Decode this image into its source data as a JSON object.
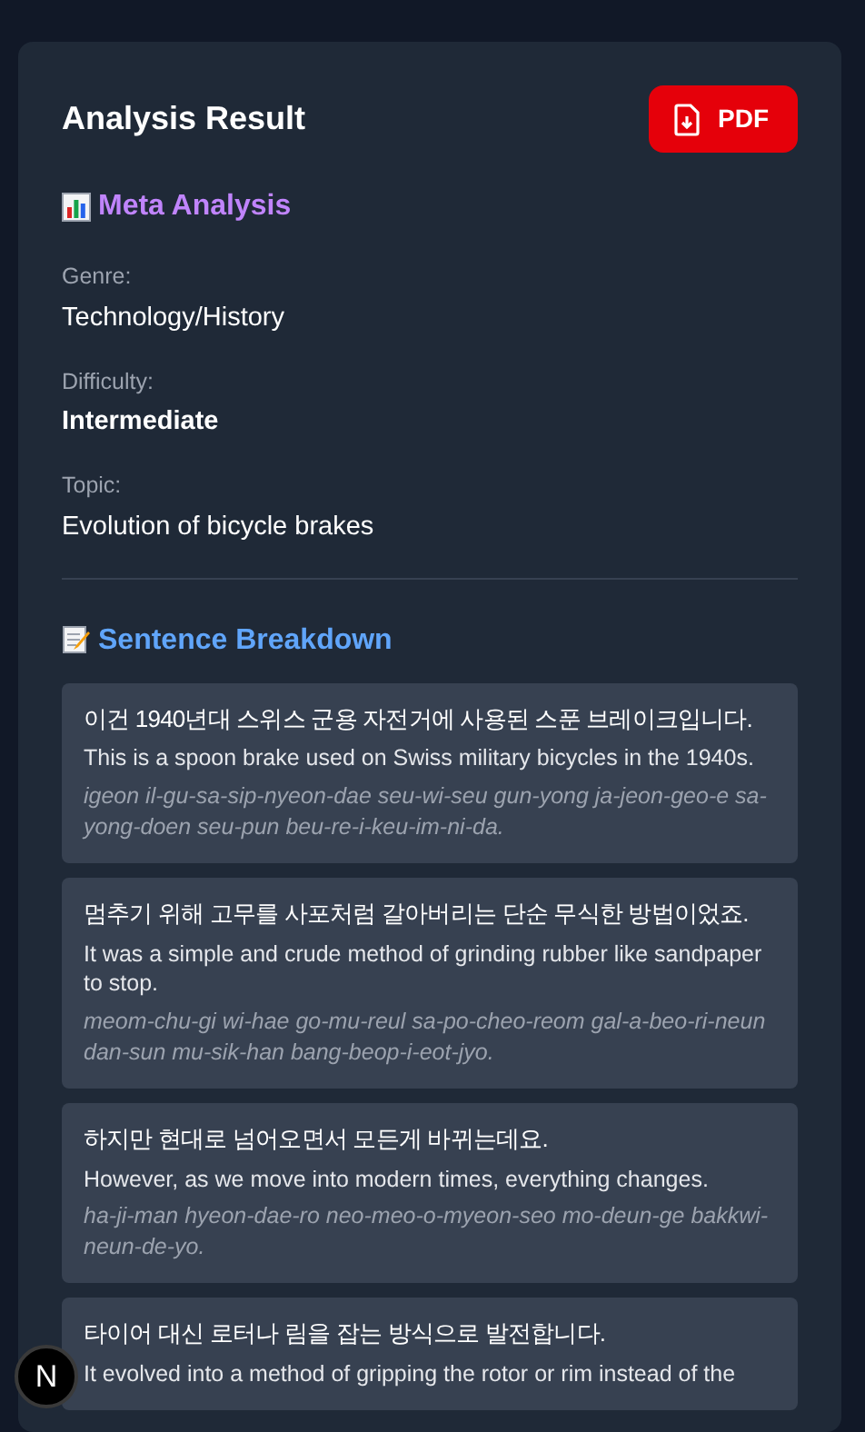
{
  "header": {
    "title": "Analysis Result",
    "button": {
      "label": "PDF"
    }
  },
  "meta": {
    "heading": "Meta Analysis",
    "fields": [
      {
        "label": "Genre:",
        "value": "Technology/History",
        "bold": false
      },
      {
        "label": "Difficulty:",
        "value": "Intermediate",
        "bold": true
      },
      {
        "label": "Topic:",
        "value": "Evolution of bicycle brakes",
        "bold": false
      }
    ]
  },
  "breakdown": {
    "heading": "Sentence Breakdown",
    "sentences": [
      {
        "korean": "이건 1940년대 스위스 군용 자전거에 사용된 스푼 브레이크입니다.",
        "english": "This is a spoon brake used on Swiss military bicycles in the 1940s.",
        "romanization": "igeon il-gu-sa-sip-nyeon-dae seu-wi-seu gun-yong ja-jeon-geo-e sa-yong-doen seu-pun beu-re-i-keu-im-ni-da."
      },
      {
        "korean": "멈추기 위해 고무를 사포처럼 갈아버리는 단순 무식한 방법이었죠.",
        "english": "It was a simple and crude method of grinding rubber like sandpaper to stop.",
        "romanization": "meom-chu-gi wi-hae go-mu-reul sa-po-cheo-reom gal-a-beo-ri-neun dan-sun mu-sik-han bang-beop-i-eot-jyo."
      },
      {
        "korean": "하지만 현대로 넘어오면서 모든게 바뀌는데요.",
        "english": "However, as we move into modern times, everything changes.",
        "romanization": "ha-ji-man hyeon-dae-ro neo-meo-o-myeon-seo mo-deun-ge bakkwi-neun-de-yo."
      },
      {
        "korean": "타이어 대신 로터나 림을 잡는 방식으로 발전합니다.",
        "english": "It evolved into a method of gripping the rotor or rim instead of the"
      }
    ]
  },
  "dev_badge": {
    "label": "N"
  }
}
